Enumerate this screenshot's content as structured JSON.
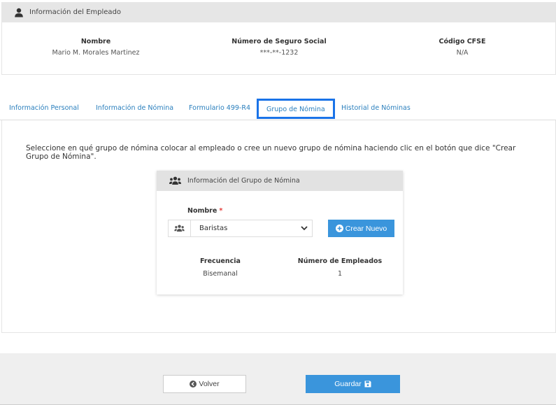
{
  "employee_card": {
    "title": "Información del Empleado",
    "icon": "user-icon",
    "fields": {
      "nombre": {
        "label": "Nombre",
        "value": "Mario M. Morales Martinez"
      },
      "ssn": {
        "label": "Número de Seguro Social",
        "value": "***-**-1232"
      },
      "cfse": {
        "label": "Código CFSE",
        "value": "N/A"
      }
    }
  },
  "tabs": {
    "personal": "Información Personal",
    "nomina": "Información de Nómina",
    "formulario": "Formulario 499-R4",
    "grupo": "Grupo de Nómina",
    "historial": "Historial de Nóminas",
    "active": "Grupo de Nómina"
  },
  "instructions": "Seleccione en qué grupo de nómina colocar al empleado o cree un nuevo grupo de nómina haciendo clic en el botón que dice \"Crear Grupo de Nómina\".",
  "group_card": {
    "title": "Información del Grupo de Nómina",
    "icon": "users-icon",
    "nombre_label": "Nombre",
    "required_mark": "*",
    "selected_group": "Baristas",
    "crear_button": "Crear Nuevo",
    "frecuencia_label": "Frecuencia",
    "frecuencia_value": "Bisemanal",
    "empleados_label": "Número de Empleados",
    "empleados_value": "1"
  },
  "footer": {
    "volver_button": "Volver",
    "guardar_button": "Guardar"
  },
  "colors": {
    "accent": "#3a95dc",
    "tab_link": "#2a7fbd",
    "active_tab_border": "#1a73e8",
    "required": "#e53935"
  }
}
